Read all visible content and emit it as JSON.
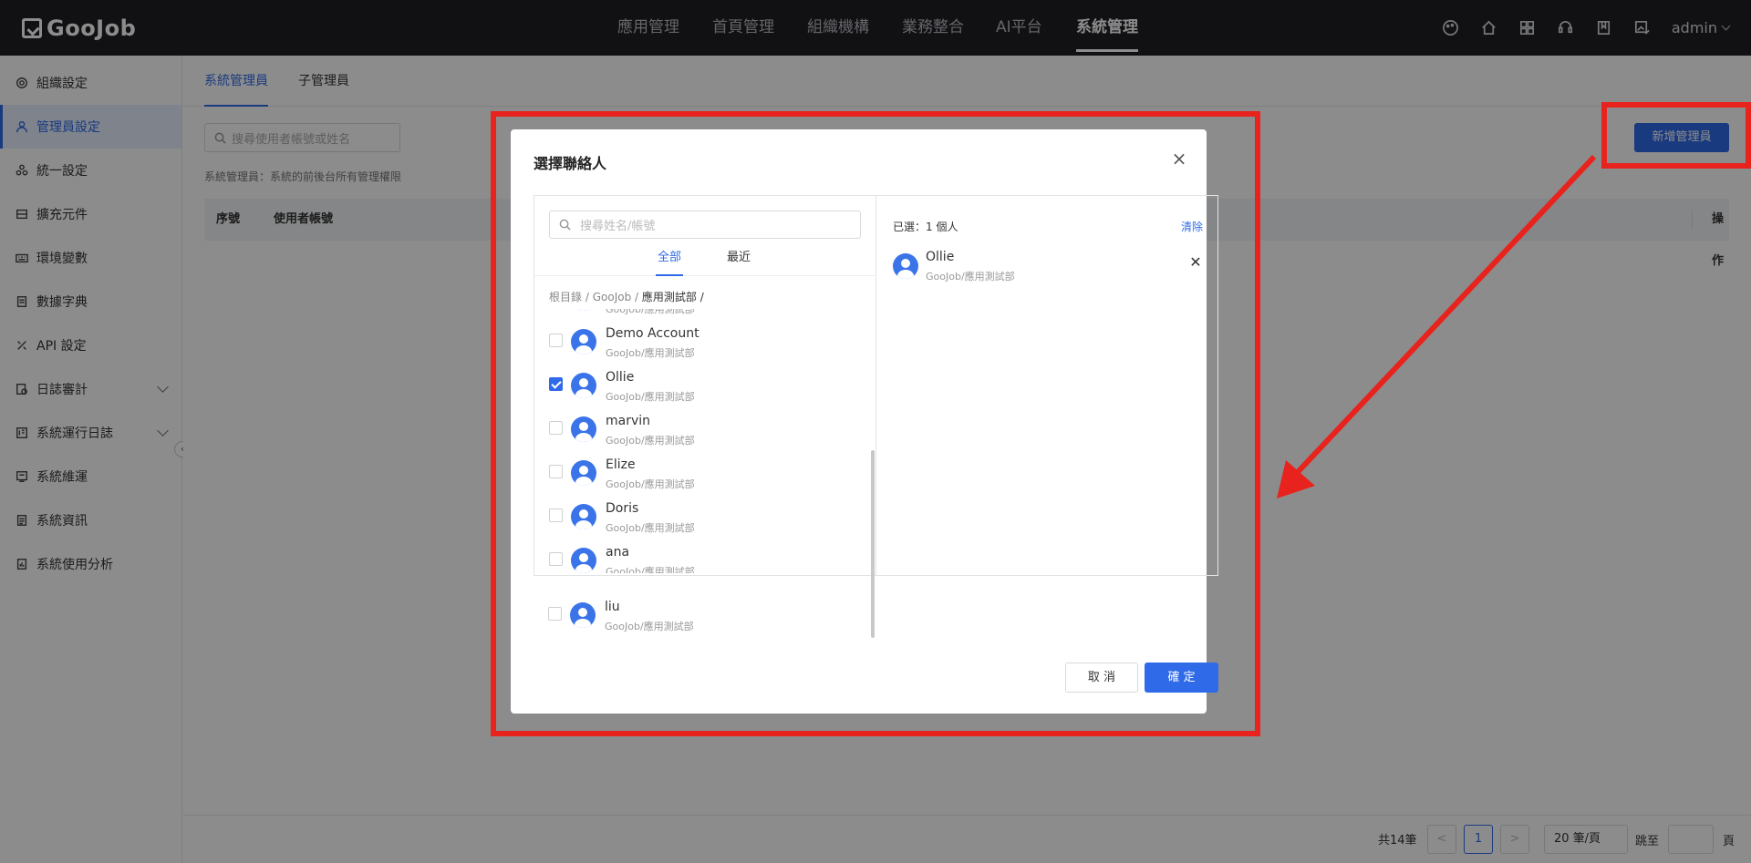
{
  "app": {
    "logo": "GooJob",
    "user": "admin"
  },
  "topnav": {
    "items": [
      "應用管理",
      "首頁管理",
      "組織機構",
      "業務整合",
      "AI平台",
      "系統管理"
    ]
  },
  "sidebar": {
    "items": [
      {
        "label": "組織設定"
      },
      {
        "label": "管理員設定"
      },
      {
        "label": "統一設定"
      },
      {
        "label": "擴充元件"
      },
      {
        "label": "環境變數"
      },
      {
        "label": "數據字典"
      },
      {
        "label": "API 設定"
      },
      {
        "label": "日誌審計"
      },
      {
        "label": "系統運行日誌"
      },
      {
        "label": "系統維運"
      },
      {
        "label": "系統資訊"
      },
      {
        "label": "系統使用分析"
      }
    ]
  },
  "main": {
    "tabs": [
      "系統管理員",
      "子管理員"
    ],
    "search_placeholder": "搜尋使用者帳號或姓名",
    "hint": "系統管理員：系統的前後台所有管理權限",
    "add_button": "新增管理員",
    "columns": [
      "序號",
      "使用者帳號",
      "操作"
    ]
  },
  "pagination": {
    "total": "共14筆",
    "current": "1",
    "page_size": "20 筆/頁",
    "jump_label": "跳至",
    "page_suffix": "頁",
    "prev": "<",
    "next": ">"
  },
  "modal": {
    "title": "選擇聯絡人",
    "search_placeholder": "搜尋姓名/帳號",
    "tabs": [
      "全部",
      "最近"
    ],
    "breadcrumb": {
      "root": "根目錄",
      "sep": "/",
      "org": "GooJob",
      "current": "應用測試部 /"
    },
    "contacts": [
      {
        "name": "",
        "dept": "GooJob/應用測試部",
        "checked": false
      },
      {
        "name": "Demo Account",
        "dept": "GooJob/應用測試部",
        "checked": false
      },
      {
        "name": "Ollie",
        "dept": "GooJob/應用測試部",
        "checked": true
      },
      {
        "name": "marvin",
        "dept": "GooJob/應用測試部",
        "checked": false
      },
      {
        "name": "Elize",
        "dept": "GooJob/應用測試部",
        "checked": false
      },
      {
        "name": "Doris",
        "dept": "GooJob/應用測試部",
        "checked": false
      },
      {
        "name": "ana",
        "dept": "GooJob/應用測試部",
        "checked": false
      },
      {
        "name": "liu",
        "dept": "GooJob/應用測試部",
        "checked": false
      }
    ],
    "selected_count": "已選：1 個人",
    "clear": "清除",
    "selected": [
      {
        "name": "Ollie",
        "dept": "GooJob/應用測試部"
      }
    ],
    "cancel": "取 消",
    "confirm": "確 定"
  },
  "colors": {
    "accent": "#2f6ae8",
    "annotation": "#e8231d",
    "topbar": "#1f2026"
  }
}
